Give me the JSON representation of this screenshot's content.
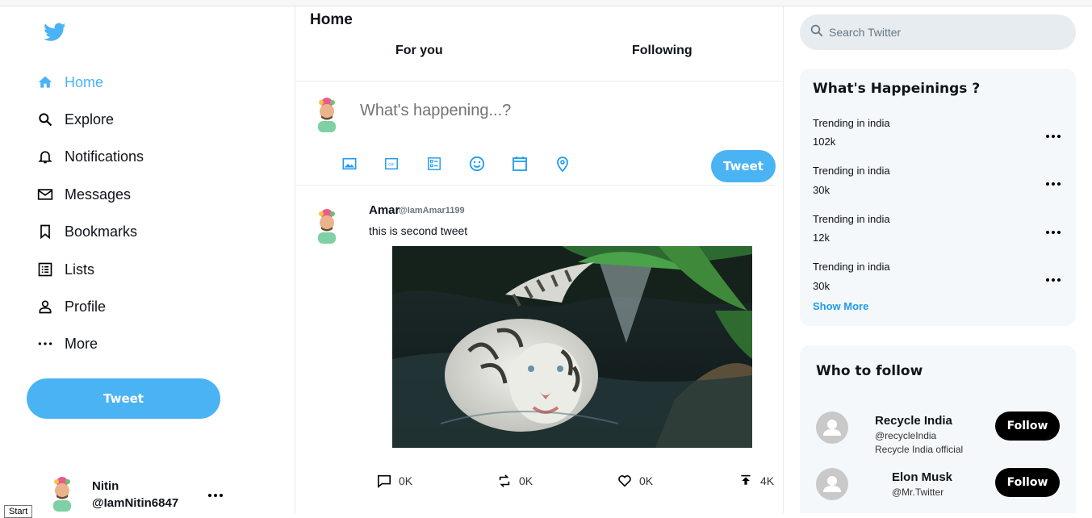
{
  "sidebar": {
    "items": [
      {
        "label": "Home",
        "icon": "home-icon"
      },
      {
        "label": "Explore",
        "icon": "search-icon"
      },
      {
        "label": "Notifications",
        "icon": "bell-icon"
      },
      {
        "label": "Messages",
        "icon": "mail-icon"
      },
      {
        "label": "Bookmarks",
        "icon": "bookmark-icon"
      },
      {
        "label": "Lists",
        "icon": "list-icon"
      },
      {
        "label": "Profile",
        "icon": "person-icon"
      },
      {
        "label": "More",
        "icon": "more-horizontal-icon"
      }
    ],
    "tweet_label": "Tweet",
    "user": {
      "name": "Nitin",
      "handle": "@IamNitin6847"
    },
    "tooltip": "Start"
  },
  "feed": {
    "title": "Home",
    "tabs": [
      "For you",
      "Following"
    ],
    "compose": {
      "placeholder": "What's happening...?",
      "tweet_label": "Tweet"
    },
    "post": {
      "name": "Amar",
      "handle": "@IamAmar1199",
      "text": "this is second tweet",
      "image_alt": "white tiger in water",
      "actions": {
        "reply": "0K",
        "retweet": "0K",
        "like": "0K",
        "share": "4K"
      }
    }
  },
  "right": {
    "search_placeholder": "Search Twitter",
    "trends_title": "What's Happeinings ?",
    "trends": [
      {
        "label": "Trending in india",
        "count": "102k"
      },
      {
        "label": "Trending in india",
        "count": "30k"
      },
      {
        "label": "Trending in india",
        "count": "12k"
      },
      {
        "label": "Trending in india",
        "count": "30k"
      }
    ],
    "show_more": "Show More",
    "follow_title": "Who to follow",
    "follow": [
      {
        "name": "Recycle India",
        "handle": "@recycleIndia",
        "bio": "Recycle India official",
        "button": "Follow"
      },
      {
        "name": "Elon Musk",
        "handle": "@Mr.Twitter",
        "button": "Follow"
      }
    ]
  },
  "colors": {
    "accent": "#4ab3f4",
    "link": "#1d9bf0",
    "panel": "#f5f8fa"
  }
}
